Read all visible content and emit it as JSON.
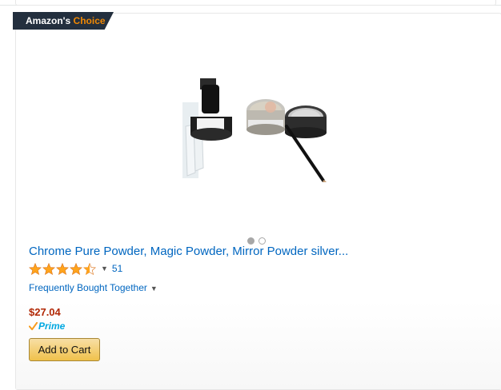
{
  "badge": {
    "prefix": "Amazon's",
    "highlight": "Choice"
  },
  "product": {
    "title": "Chrome Pure Powder, Magic Powder, Mirror Powder silver...",
    "rating": 4.5,
    "review_count": "51",
    "frequently_bought": "Frequently Bought Together",
    "price": "$27.04",
    "prime_label": "Prime",
    "add_to_cart": "Add to Cart"
  },
  "carousel": {
    "total": 2,
    "active": 1
  },
  "colors": {
    "link": "#0066c0",
    "price": "#b12704",
    "star": "#ffa41c",
    "badge_bg": "#232f3e",
    "badge_accent": "#f08804",
    "prime": "#00a8e1"
  },
  "icons": [
    "star-icon",
    "half-star-icon",
    "chevron-down-icon",
    "prime-check-icon"
  ]
}
